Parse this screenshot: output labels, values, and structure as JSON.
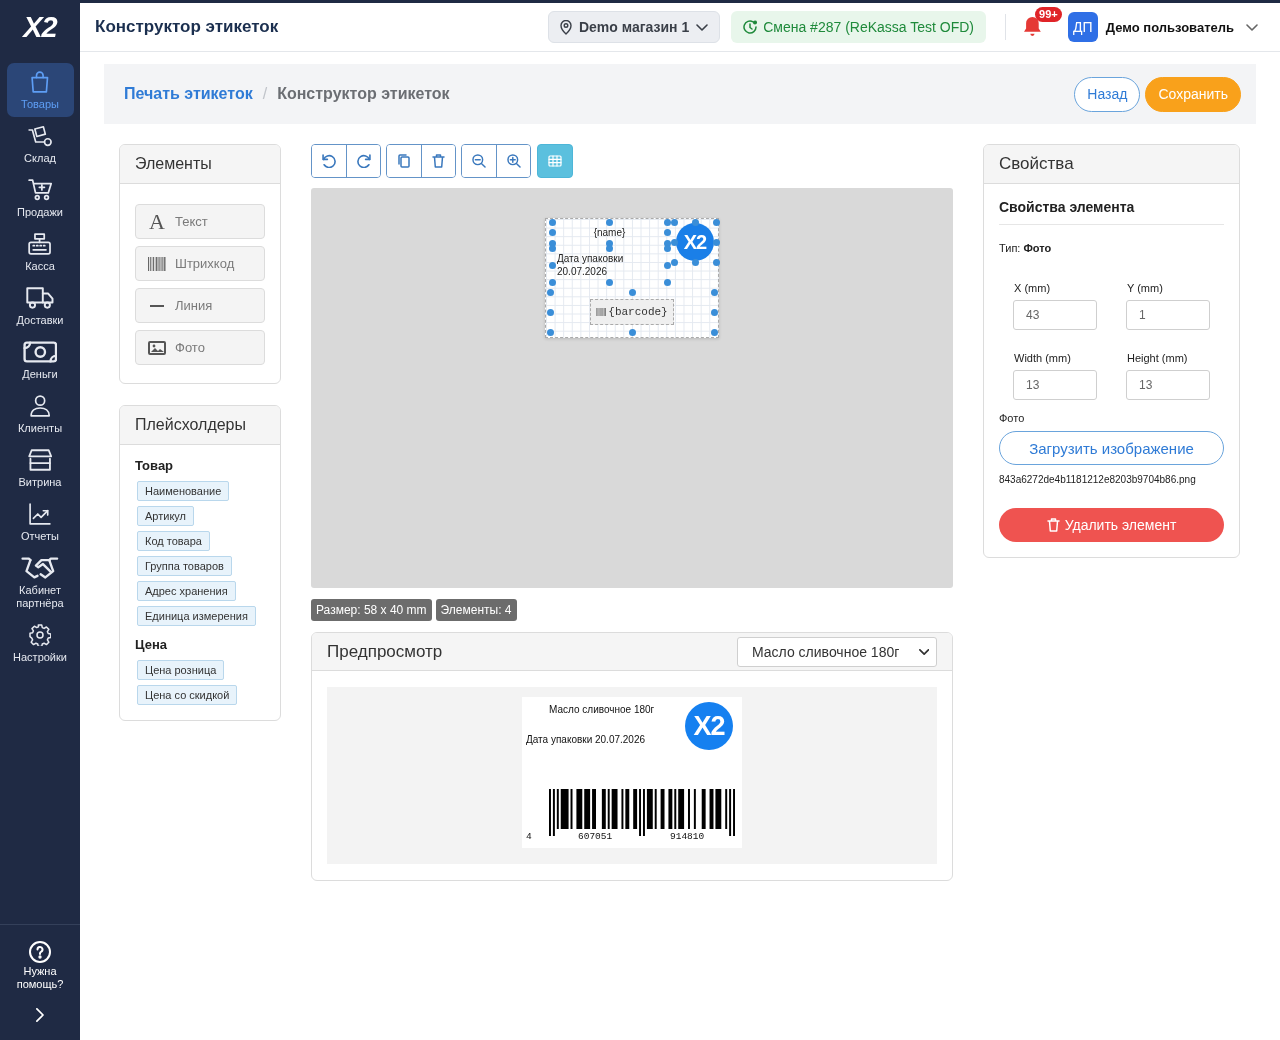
{
  "sidebar": {
    "logo": "X2",
    "items": [
      {
        "label": "Товары",
        "selected": true
      },
      {
        "label": "Склад",
        "selected": false
      },
      {
        "label": "Продажи",
        "selected": false
      },
      {
        "label": "Касса",
        "selected": false
      },
      {
        "label": "Доставки",
        "selected": false
      },
      {
        "label": "Деньги",
        "selected": false
      },
      {
        "label": "Клиенты",
        "selected": false
      },
      {
        "label": "Витрина",
        "selected": false
      },
      {
        "label": "Отчеты",
        "selected": false
      },
      {
        "label": "Кабинет партнёра",
        "selected": false
      },
      {
        "label": "Настройки",
        "selected": false
      }
    ],
    "help": "Нужна помощь?"
  },
  "topbar": {
    "title": "Конструктор этикеток",
    "store": "Demo магазин 1",
    "shift": "Смена #287 (ReKassa Test OFD)",
    "notifications": "99+",
    "user": {
      "initials": "ДП",
      "name": "Демо пользователь"
    }
  },
  "breadcrumb": {
    "items": [
      "Печать этикеток",
      "Конструктор этикеток"
    ],
    "separator": "/",
    "buttons": [
      {
        "label": "Назад",
        "kind": "outline"
      },
      {
        "label": "Сохранить",
        "kind": "primary"
      }
    ]
  },
  "elements_panel": {
    "title": "Элементы",
    "items": [
      {
        "label": "Текст",
        "glyph": "A"
      },
      {
        "label": "Штрихкод"
      },
      {
        "label": "Линия"
      },
      {
        "label": "Фото"
      }
    ]
  },
  "placeholders_panel": {
    "title": "Плейсхолдеры",
    "groups": [
      {
        "title": "Товар",
        "tags": [
          "Наименование",
          "Артикул",
          "Код товара",
          "Группа товаров",
          "Адрес хранения",
          "Единица измерения"
        ]
      },
      {
        "title": "Цена",
        "tags": [
          "Цена розница",
          "Цена со скидкой"
        ]
      }
    ]
  },
  "toolbar": {
    "grid_on": true
  },
  "canvas": {
    "elements": [
      {
        "kind": "text",
        "text": "{name}"
      },
      {
        "kind": "text",
        "text": "Дата упаковки 20.07.2026"
      },
      {
        "kind": "image",
        "text": "X2"
      },
      {
        "kind": "barcode",
        "text": "{barcode}"
      }
    ],
    "badges": [
      "Размер: 58 x 40 mm",
      "Элементы: 4"
    ]
  },
  "preview": {
    "title": "Предпросмотр",
    "product": "Масло сливочное 180г",
    "label": {
      "name": "Масло сливочное 180г",
      "date": "Дата упаковки 20.07.2026",
      "logo": "X2",
      "barcode_digits": [
        "4",
        "607051",
        "914810"
      ]
    }
  },
  "properties": {
    "title": "Свойства",
    "section": "Свойства элемента",
    "type_line": "Тип: **Фото**",
    "fields": [
      {
        "label": "X (mm)",
        "value": "43"
      },
      {
        "label": "Y (mm)",
        "value": "1"
      },
      {
        "label": "Width (mm)",
        "value": "13"
      },
      {
        "label": "Height (mm)",
        "value": "13"
      }
    ],
    "photo_label": "Фото",
    "upload_button": "Загрузить изображение",
    "file_name": "843a6272de4b1181212e8203b9704b86.png",
    "delete_button": "Удалить элемент"
  }
}
